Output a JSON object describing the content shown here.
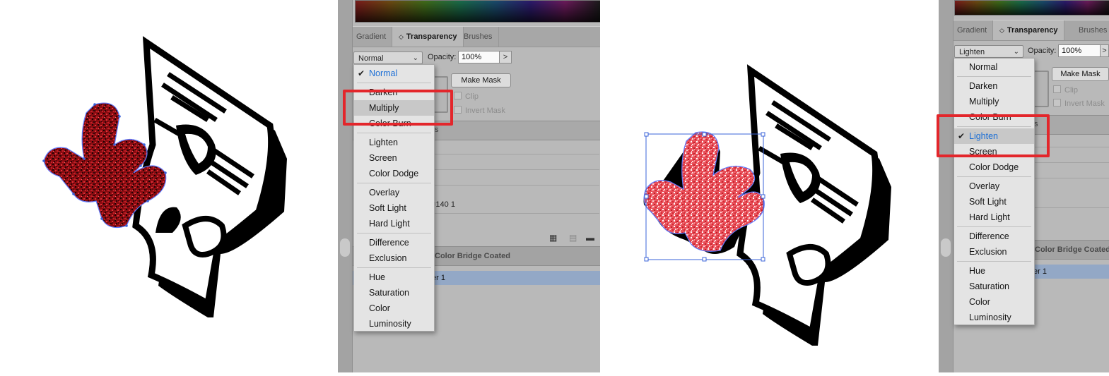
{
  "left_panel": {
    "tabs": [
      "Gradient",
      "Transparency",
      "Brushes"
    ],
    "active_tab": "Transparency",
    "tab_arrows": "◇",
    "blend_mode_value": "Normal",
    "opacity_label": "Opacity:",
    "opacity_value": "100%",
    "flyout_arrow": ">",
    "make_mask_label": "Make Mask",
    "clip_label": "Clip",
    "invert_mask_label": "Invert Mask",
    "partial_tab_text": "s",
    "partial_row_text": "=140 1",
    "swatch_section_label": "Color Bridge Coated",
    "layer_partial_text": "er 1",
    "highlighted_item": "Multiply",
    "selected_item": "Normal"
  },
  "right_panel": {
    "tabs": [
      "Gradient",
      "Transparency",
      "Brushes"
    ],
    "active_tab": "Transparency",
    "tab_arrows": "◇",
    "blend_mode_value": "Lighten",
    "opacity_label": "Opacity:",
    "opacity_value": "100%",
    "flyout_arrow": ">",
    "make_mask_label": "Make Mask",
    "clip_label": "Clip",
    "invert_mask_label": "Invert Mask",
    "partial_tab_text": "s",
    "swatch_section_label": "Color Bridge Coated",
    "layer_partial_text": "er 1",
    "highlighted_item": "Lighten",
    "selected_item": "Lighten"
  },
  "blend_modes": {
    "group1": [
      "Normal"
    ],
    "group2": [
      "Darken",
      "Multiply",
      "Color Burn"
    ],
    "group3": [
      "Lighten",
      "Screen",
      "Color Dodge"
    ],
    "group4": [
      "Overlay",
      "Soft Light",
      "Hard Light"
    ],
    "group5": [
      "Difference",
      "Exclusion"
    ],
    "group6": [
      "Hue",
      "Saturation",
      "Color",
      "Luminosity"
    ]
  },
  "checkmark": "✔",
  "chevron_down": "⌄",
  "colors": {
    "highlight_box": "#e3262b",
    "selected_text": "#1c6fd6",
    "texture_dark_red": "#b0141a",
    "texture_light_red": "#e8505a",
    "selection_blue": "#3a63d8"
  },
  "footer_icons": [
    "new-swatch-group-icon",
    "new-layer-icon",
    "folder-icon"
  ]
}
